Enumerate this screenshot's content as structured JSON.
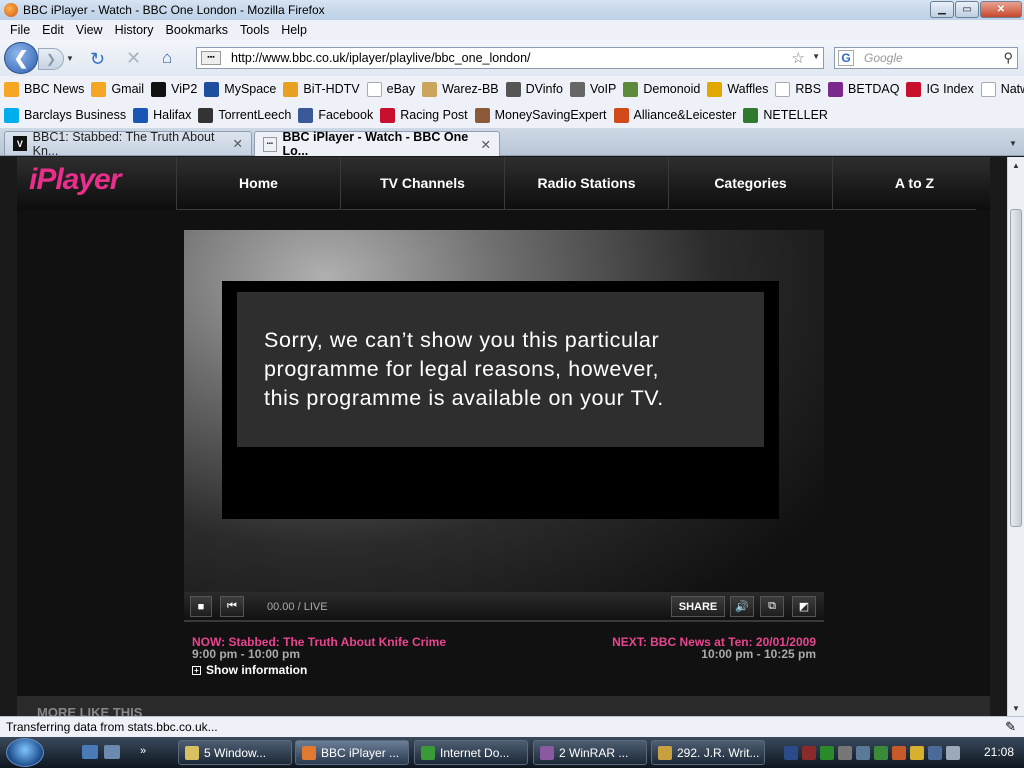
{
  "window": {
    "title": "BBC iPlayer - Watch - BBC One London - Mozilla Firefox",
    "min": "▁",
    "max": "▭",
    "close": "✕"
  },
  "menu": [
    "File",
    "Edit",
    "View",
    "History",
    "Bookmarks",
    "Tools",
    "Help"
  ],
  "nav": {
    "url": "http://www.bbc.co.uk/iplayer/playlive/bbc_one_london/",
    "search_placeholder": "Google"
  },
  "bookmarks_row1": [
    {
      "label": "BBC News",
      "icon": "rss-icon",
      "color": "#f5a623"
    },
    {
      "label": "Gmail",
      "icon": "rss-icon",
      "color": "#f5a623"
    },
    {
      "label": "ViP2",
      "icon": "v-icon",
      "color": "#111111"
    },
    {
      "label": "MySpace",
      "icon": "myspace-icon",
      "color": "#1d4f9e"
    },
    {
      "label": "BiT-HDTV",
      "icon": "share-icon",
      "color": "#e8a020"
    },
    {
      "label": "eBay",
      "icon": "page-icon",
      "color": "#ffffff"
    },
    {
      "label": "Warez-BB",
      "icon": "wbb-icon",
      "color": "#c9a65b"
    },
    {
      "label": "DVinfo",
      "icon": "info-icon",
      "color": "#555555"
    },
    {
      "label": "VoIP",
      "icon": "voip-icon",
      "color": "#666666"
    },
    {
      "label": "Demonoid",
      "icon": "demonoid-icon",
      "color": "#5a8a3a"
    },
    {
      "label": "Waffles",
      "icon": "waffles-icon",
      "color": "#e0a800"
    },
    {
      "label": "RBS",
      "icon": "page-icon",
      "color": "#ffffff"
    },
    {
      "label": "BETDAQ",
      "icon": "betdaq-icon",
      "color": "#7a2a8c"
    },
    {
      "label": "IG Index",
      "icon": "ig-icon",
      "color": "#c8102e"
    },
    {
      "label": "Natwest",
      "icon": "page-icon",
      "color": "#ffffff"
    }
  ],
  "bookmarks_row2": [
    {
      "label": "Barclays Business",
      "icon": "barclays-icon",
      "color": "#00aeef"
    },
    {
      "label": "Halifax",
      "icon": "halifax-icon",
      "color": "#1a57b5"
    },
    {
      "label": "TorrentLeech",
      "icon": "torrentleech-icon",
      "color": "#333333"
    },
    {
      "label": "Facebook",
      "icon": "facebook-icon",
      "color": "#3b5998"
    },
    {
      "label": "Racing Post",
      "icon": "racingpost-icon",
      "color": "#c8102e"
    },
    {
      "label": "MoneySavingExpert",
      "icon": "mse-icon",
      "color": "#8a5a3a"
    },
    {
      "label": "Alliance&Leicester",
      "icon": "aandl-icon",
      "color": "#d04a1a"
    },
    {
      "label": "NETELLER",
      "icon": "neteller-icon",
      "color": "#2f7a2f"
    }
  ],
  "tabs": [
    {
      "label": "BBC1: Stabbed: The Truth About Kn...",
      "close": "✕"
    },
    {
      "label": "BBC iPlayer - Watch - BBC One Lo...",
      "close": "✕"
    }
  ],
  "iplayer": {
    "logo": "iPlayer",
    "nav": [
      "Home",
      "TV Channels",
      "Radio Stations",
      "Categories",
      "A to Z"
    ],
    "message_lines": [
      "Sorry, we can’t show you this particular",
      "programme for legal reasons, however,",
      "this programme is available on your TV."
    ],
    "timecode": "00.00 / LIVE",
    "share": "SHARE",
    "now_title": "NOW: Stabbed: The Truth About Knife Crime",
    "now_time": "9:00 pm - 10:00 pm",
    "show_info": "Show information",
    "next_title": "NEXT: BBC News at Ten: 20/01/2009",
    "next_time": "10:00 pm - 10:25 pm",
    "more_like_this": "MORE LIKE THIS"
  },
  "status": "Transferring data from stats.bbc.co.uk...",
  "taskbar": {
    "tasks": [
      {
        "label": "5 Window...",
        "icon": "folder-icon"
      },
      {
        "label": "BBC iPlayer ...",
        "icon": "firefox-icon"
      },
      {
        "label": "Internet Do...",
        "icon": "idm-icon"
      },
      {
        "label": "2 WinRAR ...",
        "icon": "winrar-icon"
      },
      {
        "label": "292. J.R. Writ...",
        "icon": "document-icon"
      }
    ],
    "clock": "21:08"
  }
}
